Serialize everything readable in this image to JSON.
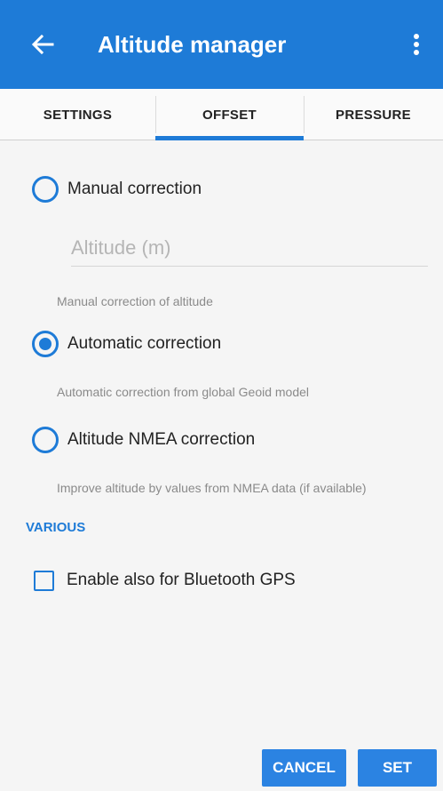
{
  "appbar": {
    "title": "Altitude manager",
    "color": "#1e7bd7",
    "back_icon": "arrow-left-icon",
    "menu_icon": "more-vertical-icon"
  },
  "tabs": [
    {
      "label": "SETTINGS",
      "selected": false
    },
    {
      "label": "OFFSET",
      "selected": true
    },
    {
      "label": "PRESSURE",
      "selected": false
    }
  ],
  "options": [
    {
      "label": "Manual correction",
      "checked": false,
      "description": "Manual correction of altitude"
    },
    {
      "label": "Automatic correction",
      "checked": true,
      "description": "Automatic correction from global Geoid model"
    },
    {
      "label": "Altitude NMEA correction",
      "checked": false,
      "description": "Improve altitude by values from NMEA data (if available)"
    }
  ],
  "altitude_input": {
    "placeholder": "Altitude (m)",
    "value": ""
  },
  "various": {
    "header": "VARIOUS",
    "checkbox_label": "Enable also for Bluetooth GPS",
    "checked": false
  },
  "buttons": {
    "cancel": "CANCEL",
    "set": "SET"
  }
}
